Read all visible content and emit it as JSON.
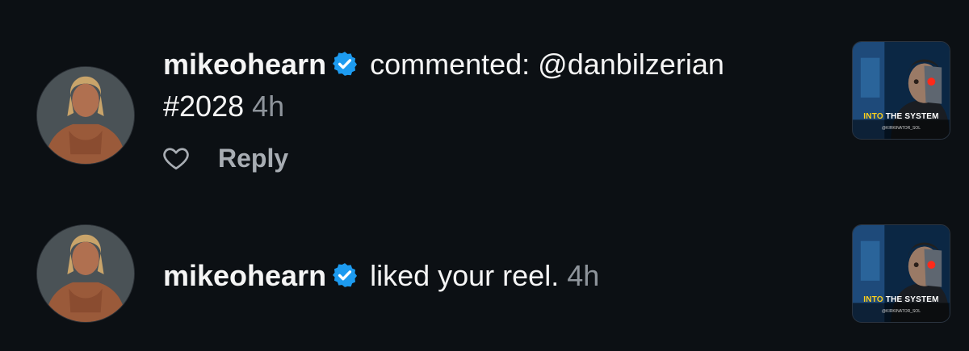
{
  "notifications": [
    {
      "username": "mikeohearn",
      "action_text": "commented: @danbilzerian",
      "action_text_line2": "#2028",
      "time": "4h",
      "reply_label": "Reply",
      "thumb": {
        "title_highlight": "INTO",
        "title_rest": "THE SYSTEM",
        "credit": "@KIRKINATOR_SOL"
      }
    },
    {
      "username": "mikeohearn",
      "action_text": "liked your reel.",
      "time": "4h",
      "thumb": {
        "title_highlight": "INTO",
        "title_rest": "THE SYSTEM",
        "credit": "@KIRKINATOR_SOL"
      }
    }
  ],
  "colors": {
    "background": "#0c1014",
    "verified_badge": "#1d9bf0",
    "muted_text": "#8e949b"
  },
  "icons": [
    "verified-badge-icon",
    "heart-icon"
  ]
}
